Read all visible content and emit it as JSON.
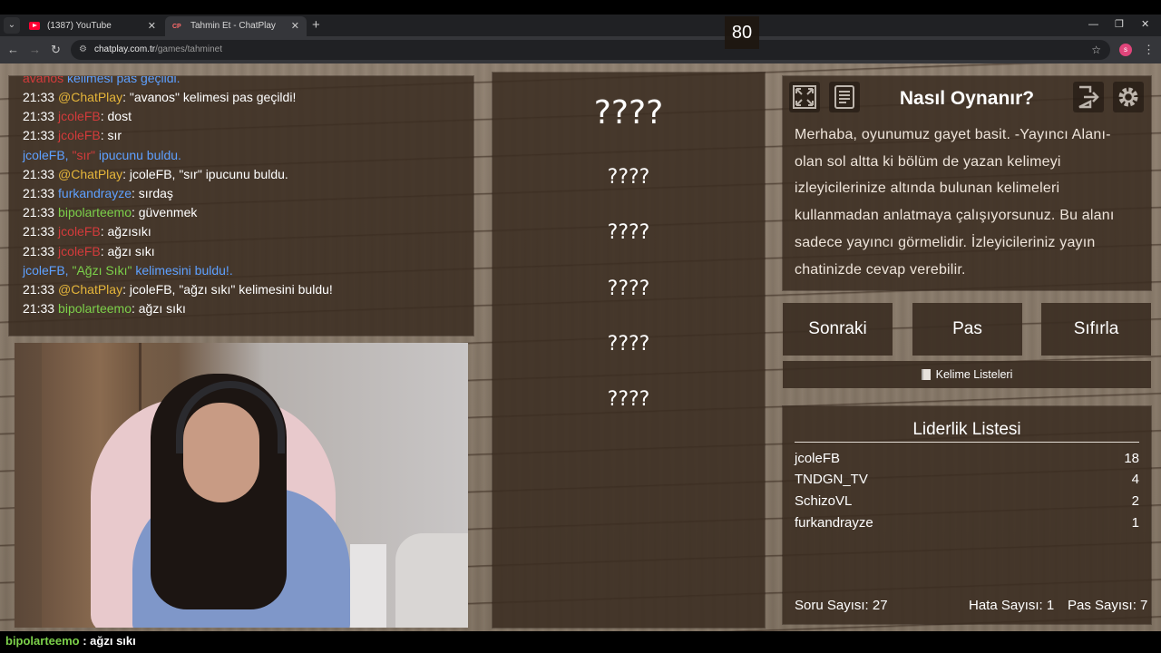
{
  "browser": {
    "tabs": [
      {
        "title": "(1387) YouTube",
        "favicon": "youtube-icon",
        "active": false
      },
      {
        "title": "Tahmin Et - ChatPlay",
        "favicon": "chatplay-icon",
        "active": true
      }
    ],
    "url_host": "chatplay.com.tr",
    "url_path": "/games/tahminet",
    "profile_initial": "s"
  },
  "chat": {
    "partial_top": {
      "user": "avanos",
      "text": " kelimesi pas geçildi."
    },
    "lines": [
      {
        "time": "21:33",
        "user": "@ChatPlay",
        "user_color": "chatplay",
        "message": ": \"avanos\" kelimesi pas geçildi!"
      },
      {
        "time": "21:33",
        "user": "jcoleFB",
        "user_color": "red",
        "message": ": dost"
      },
      {
        "time": "21:33",
        "user": "jcoleFB",
        "user_color": "red",
        "message": ": sır"
      },
      {
        "system": true,
        "parts": [
          "jcoleFB, ",
          "\"sır\"",
          " ipucunu buldu."
        ]
      },
      {
        "time": "21:33",
        "user": "@ChatPlay",
        "user_color": "chatplay",
        "message": ": jcoleFB, \"sır\" ipucunu buldu."
      },
      {
        "time": "21:33",
        "user": "furkandrayze",
        "user_color": "blue",
        "message": ": sırdaş"
      },
      {
        "time": "21:33",
        "user": "bipolarteemo",
        "user_color": "green",
        "message": ": güvenmek"
      },
      {
        "time": "21:33",
        "user": "jcoleFB",
        "user_color": "red",
        "message": ": ağzısıkı"
      },
      {
        "time": "21:33",
        "user": "jcoleFB",
        "user_color": "red",
        "message": ": ağzı sıkı"
      },
      {
        "system": true,
        "parts": [
          "jcoleFB, ",
          "\"Ağzı Sıkı\"",
          " kelimesini buldu!."
        ]
      },
      {
        "time": "21:33",
        "user": "@ChatPlay",
        "user_color": "chatplay",
        "message": ": jcoleFB, \"ağzı sıkı\" kelimesini buldu!"
      },
      {
        "time": "21:33",
        "user": "bipolarteemo",
        "user_color": "green",
        "message": ": ağzı sıkı"
      }
    ]
  },
  "game": {
    "score": "80",
    "main_word": "????",
    "hint_words": [
      "????",
      "????",
      "????",
      "????",
      "????"
    ]
  },
  "howto": {
    "title": "Nasıl Oynanır?",
    "text": "Merhaba, oyunumuz gayet basit. -Yayıncı Alanı- olan sol altta ki bölüm de yazan kelimeyi izleyicilerinize altında bulunan kelimeleri kullanmadan anlatmaya çalışıyorsunuz. Bu alanı sadece yayıncı görmelidir. İzleyicileriniz yayın chatinizde cevap verebilir."
  },
  "buttons": {
    "next": "Sonraki",
    "pass": "Pas",
    "reset": "Sıfırla",
    "word_lists": "Kelime Listeleri"
  },
  "leaderboard": {
    "title": "Liderlik Listesi",
    "rows": [
      {
        "name": "jcoleFB",
        "score": "18"
      },
      {
        "name": "TNDGN_TV",
        "score": "4"
      },
      {
        "name": "SchizoVL",
        "score": "2"
      },
      {
        "name": "furkandrayze",
        "score": "1"
      }
    ]
  },
  "stats": {
    "questions": "Soru Sayısı: 27",
    "errors": "Hata Sayısı: 1",
    "passes": "Pas Sayısı: 7"
  },
  "overlay": {
    "user": "bipolarteemo",
    "message": " : ağzı sıkı"
  },
  "colors": {
    "chatplay": "#e5b53a",
    "red": "#d33b3b",
    "blue": "#5ea0ff",
    "green": "#7cd04a"
  }
}
